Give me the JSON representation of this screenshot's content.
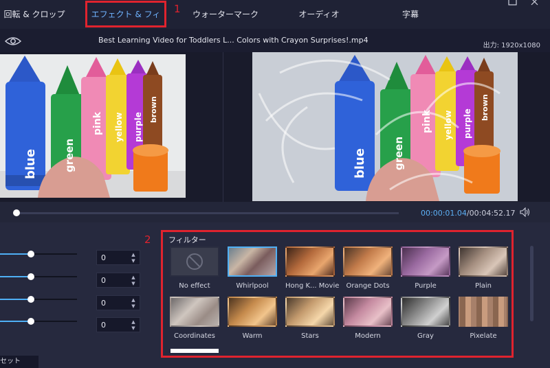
{
  "tabs": [
    {
      "label": "回転 & クロップ",
      "active": false
    },
    {
      "label": "エフェクト & フィルター",
      "active": true
    },
    {
      "label": "ウォーターマーク",
      "active": false
    },
    {
      "label": "オーディオ",
      "active": false
    },
    {
      "label": "字幕",
      "active": false
    }
  ],
  "annotations": {
    "one": "1",
    "two": "2"
  },
  "preview": {
    "filename": "Best Learning Video for Toddlers L... Colors with Crayon Surprises!.mp4",
    "output": "出力: 1920x1080",
    "crayon_labels": [
      "blue",
      "green",
      "pink",
      "yellow",
      "purple",
      "brown"
    ]
  },
  "player": {
    "progress": 0.004,
    "current_time": "00:00:01.04",
    "total_time": "/00:04:52.17"
  },
  "adjustments": [
    {
      "value": "0",
      "level": 0.4
    },
    {
      "value": "0",
      "level": 0.4
    },
    {
      "value": "0",
      "level": 0.4
    },
    {
      "value": "0",
      "level": 0.4
    }
  ],
  "reset_label": "セット",
  "filters": {
    "title": "フィルター",
    "selected": "Whirlpool",
    "items": [
      {
        "label": "No effect"
      },
      {
        "label": "Whirlpool"
      },
      {
        "label": "Hong K... Movie"
      },
      {
        "label": "Orange Dots"
      },
      {
        "label": "Purple"
      },
      {
        "label": "Plain"
      },
      {
        "label": "Coordinates"
      },
      {
        "label": "Warm"
      },
      {
        "label": "Stars"
      },
      {
        "label": "Modern"
      },
      {
        "label": "Gray"
      },
      {
        "label": "Pixelate"
      }
    ]
  },
  "colors": {
    "accent": "#4fb0f6",
    "annotation": "#e0232e",
    "background": "#1f2235"
  }
}
